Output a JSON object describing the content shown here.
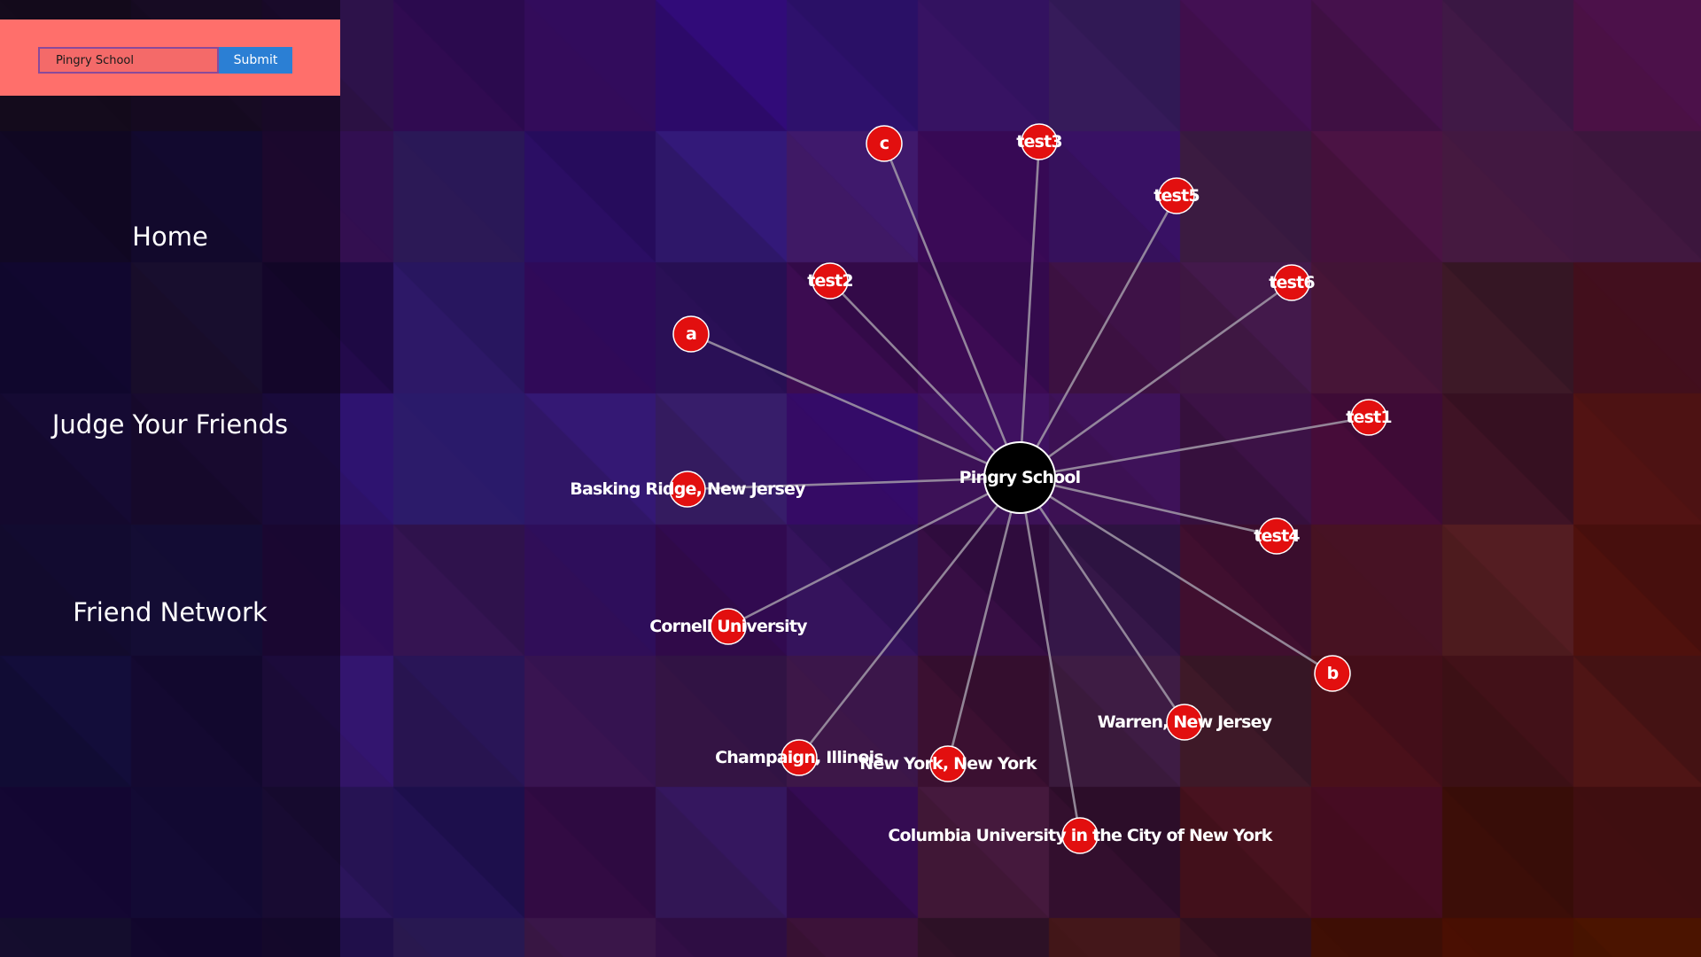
{
  "search": {
    "value": "Pingry School",
    "submit_label": "Submit"
  },
  "nav": {
    "items": [
      {
        "label": "Home"
      },
      {
        "label": "Judge Your Friends"
      },
      {
        "label": "Friend Network"
      }
    ]
  },
  "graph": {
    "center": {
      "label": "Pingry School"
    },
    "nodes": [
      {
        "label": "c"
      },
      {
        "label": "test3"
      },
      {
        "label": "test5"
      },
      {
        "label": "test2"
      },
      {
        "label": "test6"
      },
      {
        "label": "a"
      },
      {
        "label": "test1"
      },
      {
        "label": "Basking Ridge, New Jersey"
      },
      {
        "label": "test4"
      },
      {
        "label": "Cornell University"
      },
      {
        "label": "b"
      },
      {
        "label": "Warren, New Jersey"
      },
      {
        "label": "Champaign, Illinois"
      },
      {
        "label": "New York, New York"
      },
      {
        "label": "Columbia University in the City of New York"
      }
    ]
  },
  "colors": {
    "search_panel": "#ff6f6b",
    "submit_button": "#2b7fd4",
    "node_fill": "#e20f0f",
    "center_fill": "#000000",
    "edge": "#a29aa8"
  }
}
